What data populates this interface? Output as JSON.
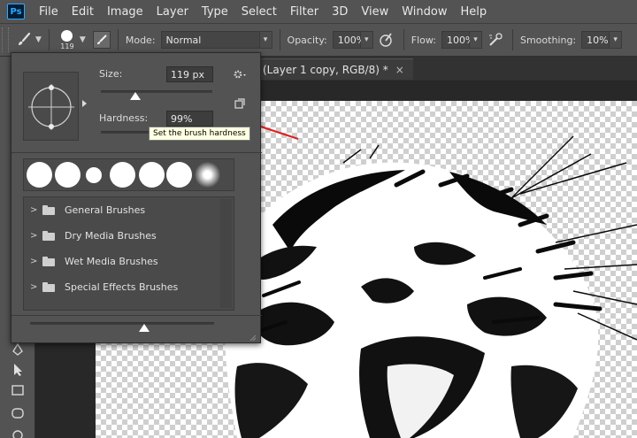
{
  "app": {
    "logo": "Ps"
  },
  "menu": [
    "File",
    "Edit",
    "Image",
    "Layer",
    "Type",
    "Select",
    "Filter",
    "3D",
    "View",
    "Window",
    "Help"
  ],
  "options_bar": {
    "brush_size": "119",
    "mode_label": "Mode:",
    "mode_value": "Normal",
    "opacity_label": "Opacity:",
    "opacity_value": "100%",
    "flow_label": "Flow:",
    "flow_value": "100%",
    "smoothing_label": "Smoothing:",
    "smoothing_value": "10%"
  },
  "document": {
    "tab_title": "(Layer 1 copy, RGB/8) *",
    "close_glyph": "×"
  },
  "brush_picker": {
    "size_label": "Size:",
    "size_value": "119 px",
    "size_level": 0.31,
    "hardness_label": "Hardness:",
    "hardness_value": "99%",
    "hardness_level": 0.99,
    "tooltip": "Set the brush hardness",
    "folders": [
      "General Brushes",
      "Dry Media Brushes",
      "Wet Media Brushes",
      "Special Effects Brushes"
    ],
    "preview_zoom_level": 0.62
  },
  "colors": {
    "annotation_arrow": "#e02020",
    "panel": "#535353",
    "background": "#282828"
  },
  "icons": {
    "tool_preset": "brush-icon",
    "brush_settings": "brush-settings-icon",
    "pressure_opacity": "pressure-opacity-icon",
    "airbrush": "airbrush-icon",
    "gear": "gear-icon"
  }
}
